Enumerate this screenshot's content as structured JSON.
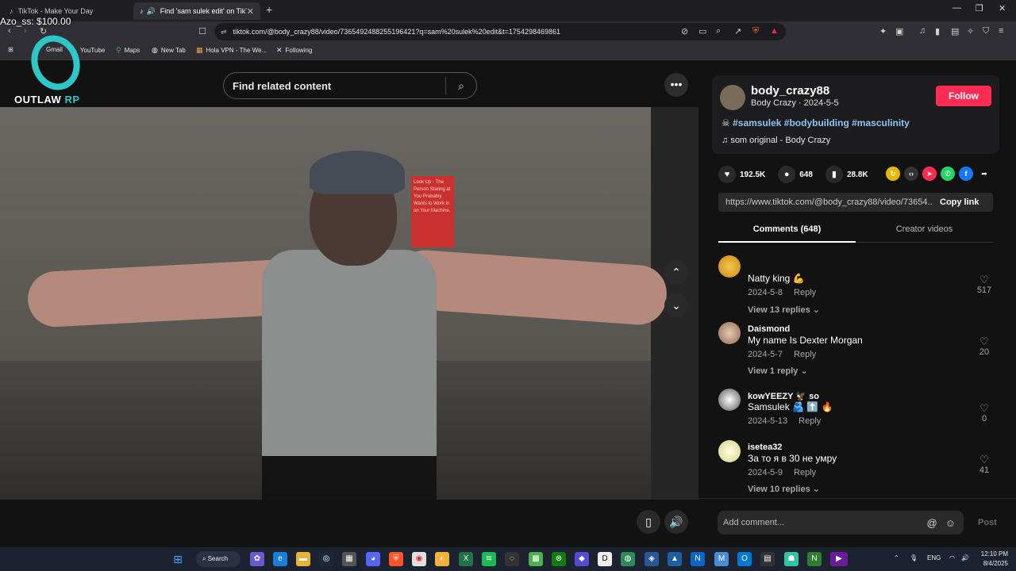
{
  "browser": {
    "tabs": [
      {
        "title": "TikTok - Make Your Day"
      },
      {
        "title": "Find 'sam sulek edit' on TikTok"
      }
    ],
    "url": "tiktok.com/@body_crazy88/video/7365492488255196421?q=sam%20sulek%20edit&t=1754298469861",
    "bookmarks": [
      "Gmail",
      "YouTube",
      "Maps",
      "New Tab",
      "Hola VPN - The We...",
      "Following"
    ]
  },
  "overlay": {
    "balance": "Azo_ss: $100.00",
    "logo_text_a": "OUTLAW",
    "logo_text_b": "RP"
  },
  "search": {
    "placeholder": "Find related content"
  },
  "video": {
    "sign_text": "Look Up - The Person Staring at You Probably Wants to Work in on Your Machine."
  },
  "author": {
    "username": "body_crazy88",
    "subtitle": "Body Crazy · 2024-5-5",
    "follow_label": "Follow",
    "hashtags": "#samsulek #bodybuilding #masculinity",
    "music": "som original - Body Crazy"
  },
  "stats": {
    "likes": "192.5K",
    "comments": "648",
    "saves": "28.8K"
  },
  "share": {
    "link": "https://www.tiktok.com/@body_crazy88/video/73654...",
    "copy_label": "Copy link"
  },
  "panel_tabs": {
    "comments": "Comments (648)",
    "creator_videos": "Creator videos"
  },
  "comments": [
    {
      "name": "",
      "text": "Natty king 💪",
      "date": "2024-5-8",
      "reply": "Reply",
      "replies": "View 13 replies",
      "likes": "517"
    },
    {
      "name": "Daismond",
      "text": "My name Is Dexter Morgan",
      "date": "2024-5-7",
      "reply": "Reply",
      "replies": "View 1 reply",
      "likes": "20"
    },
    {
      "name": "kowYEEZY 🦅 so",
      "text": "Samsulek 🫂 ⬆️ 🔥",
      "date": "2024-5-13",
      "reply": "Reply",
      "replies": "",
      "likes": "0"
    },
    {
      "name": "isetea32",
      "text": "За то я в 30 не умру",
      "date": "2024-5-9",
      "reply": "Reply",
      "replies": "View 10 replies",
      "likes": "41"
    }
  ],
  "add_comment": {
    "placeholder": "Add comment...",
    "post_label": "Post"
  },
  "taskbar": {
    "search_label": "Search",
    "lang": "ENG",
    "time": "12:10 PM",
    "date": "8/4/2025"
  },
  "colors": {
    "accent": "#fe2c55",
    "hashtag": "#8fc4f6",
    "logo": "#2ec7c7"
  }
}
